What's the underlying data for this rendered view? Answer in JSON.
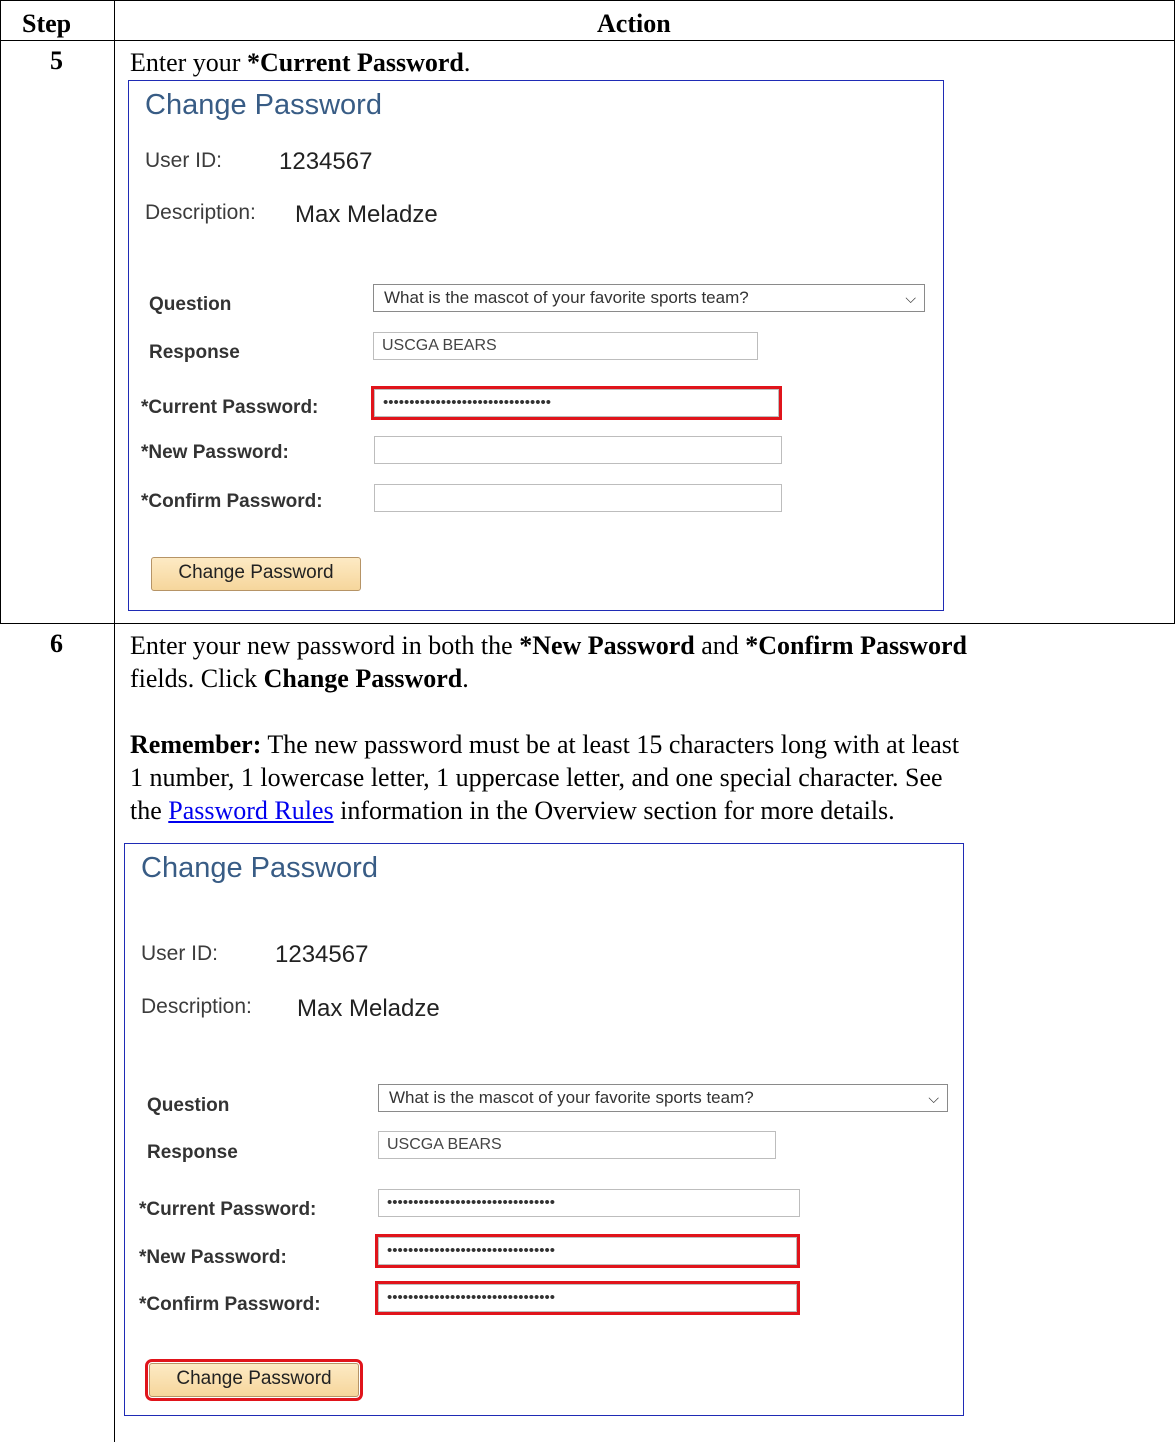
{
  "table": {
    "header_step": "Step",
    "header_action": "Action"
  },
  "steps": [
    {
      "number": "5",
      "text_pre": "Enter your ",
      "text_bold": "*Current Password",
      "text_post": "."
    },
    {
      "number": "6",
      "p1_a": "Enter your new password in both the ",
      "p1_b": "*New Password",
      "p1_c": " and ",
      "p1_d": "*Confirm Password",
      "p1_e": "fields. Click ",
      "p1_f": "Change Password",
      "p1_g": ".",
      "remember_label": "Remember:",
      "remember_line1": " The new password must be at least 15 characters long with at least",
      "remember_line2": "1 number, 1 lowercase letter, 1 uppercase letter, and one special character.  See",
      "remember_line3_pre": "the ",
      "remember_link": "Password Rules",
      "remember_line3_post": " information in the Overview section for more details."
    }
  ],
  "form": {
    "title": "Change Password",
    "user_id_label": "User ID:",
    "user_id_value": "1234567",
    "description_label": "Description:",
    "description_value": "Max Meladze",
    "question_label": "Question",
    "question_value": "What is the mascot of your favorite sports team?",
    "response_label": "Response",
    "response_value": "USCGA BEARS",
    "current_password_label": "*Current Password:",
    "new_password_label": "*New Password:",
    "confirm_password_label": "*Confirm Password:",
    "masked_value": "••••••••••••••••••••••••••••••••",
    "button_label": "Change Password"
  },
  "colors": {
    "highlight": "#e0141b",
    "frame": "#1f2bb5",
    "title": "#385c85"
  }
}
